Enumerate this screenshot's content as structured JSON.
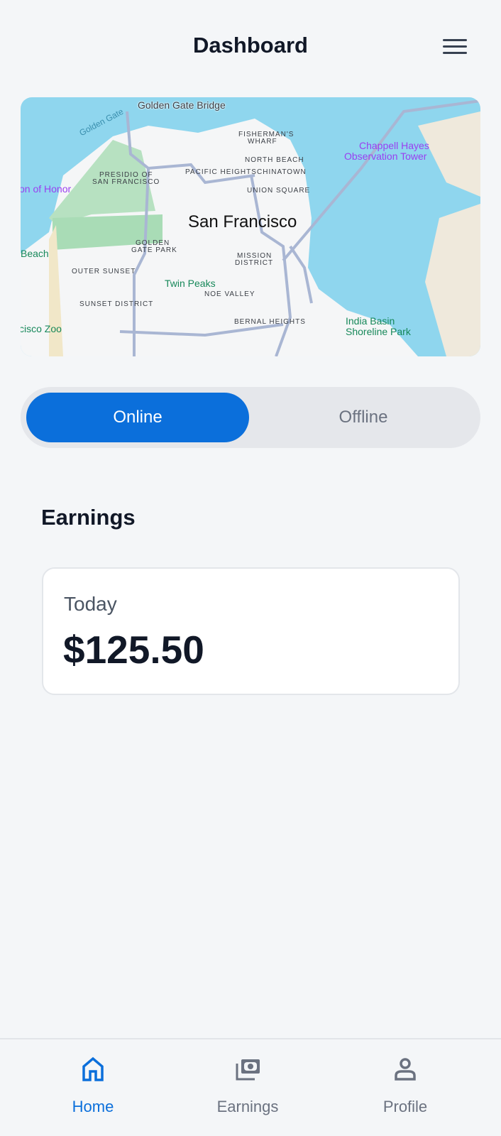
{
  "header": {
    "title": "Dashboard",
    "menu_icon": "hamburger-menu-icon"
  },
  "map": {
    "city": "San Francisco",
    "labels": {
      "golden_gate_bridge": "Golden Gate Bridge",
      "golden_gate": "Golden Gate",
      "fishermans_wharf_1": "FISHERMAN'S",
      "fishermans_wharf_2": "WHARF",
      "north_beach": "NORTH BEACH",
      "pacific_heights": "PACIFIC HEIGHTS",
      "chinatown": "CHINATOWN",
      "presidio_1": "PRESIDIO OF",
      "presidio_2": "SAN FRANCISCO",
      "union_square": "UNION SQUARE",
      "legion_of_honor": "on of Honor",
      "golden_gate_park_1": "GOLDEN",
      "golden_gate_park_2": "GATE PARK",
      "mission_1": "MISSION",
      "mission_2": "DISTRICT",
      "beach": "Beach",
      "outer_sunset": "OUTER SUNSET",
      "twin_peaks": "Twin Peaks",
      "noe_valley": "NOE VALLEY",
      "sunset_district": "SUNSET DISTRICT",
      "bernal_heights": "BERNAL HEIGHTS",
      "zoo": "cisco Zoo",
      "chappell_1": "Chappell Hayes",
      "chappell_2": "Observation Tower",
      "india_basin_1": "India Basin",
      "india_basin_2": "Shoreline Park"
    },
    "colors": {
      "water": "#8fd6ee",
      "land": "#f5f6f7",
      "park": "#a9dcb6",
      "road": "#a9b6d3"
    }
  },
  "status_toggle": {
    "online": "Online",
    "offline": "Offline",
    "selected": "Online"
  },
  "earnings": {
    "heading": "Earnings",
    "period": "Today",
    "amount": "$125.50"
  },
  "bottom_nav": {
    "items": [
      {
        "label": "Home",
        "icon": "home-icon",
        "active": true
      },
      {
        "label": "Earnings",
        "icon": "money-icon",
        "active": false
      },
      {
        "label": "Profile",
        "icon": "person-icon",
        "active": false
      }
    ]
  },
  "colors": {
    "accent": "#0b6fdb",
    "background": "#f4f6f8",
    "inactive": "#6b7280"
  }
}
